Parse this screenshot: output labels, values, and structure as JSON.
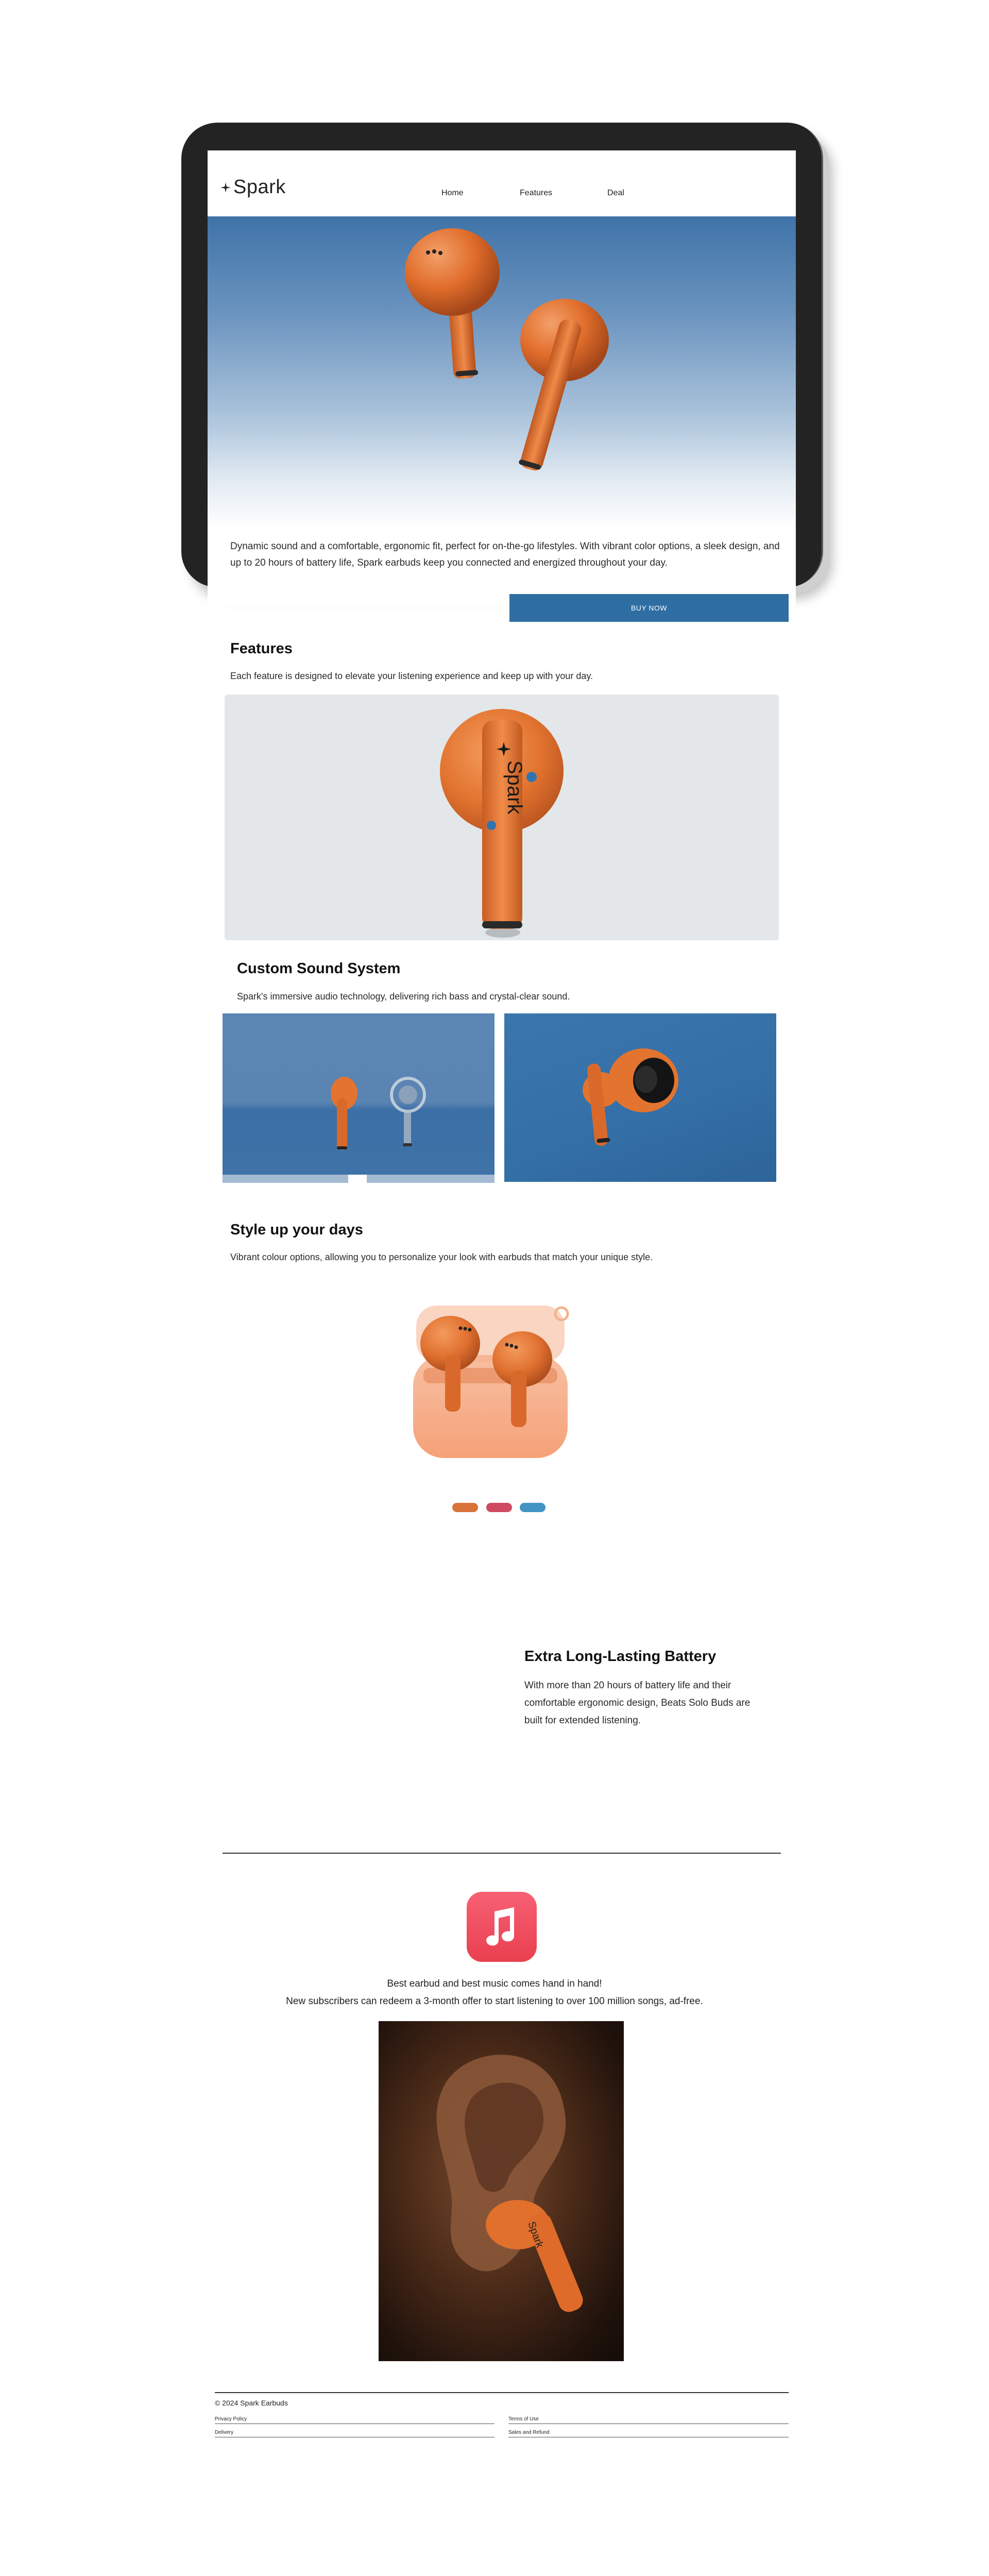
{
  "brand": {
    "name": "Spark"
  },
  "nav": {
    "items": [
      "Home",
      "Features",
      "Deal"
    ]
  },
  "hero": {
    "description": "Dynamic sound and a comfortable, ergonomic fit, perfect for on-the-go lifestyles. With vibrant color options, a sleek design, and up to 20 hours of battery life, Spark earbuds keep you connected and energized throughout your day.",
    "description_line1": "Dynamic sound and a comfortable, ergonomic fit, perfect for on-the-go lifestyles. With vibrant color options, a sleek design, and",
    "description_line2": "up to 20 hours of battery life, Spark earbuds keep you connected and energized throughout your day.",
    "buy_label": "BUY NOW"
  },
  "features": {
    "title": "Features",
    "subtitle": "Each feature is designed to elevate your listening experience and keep up with your day."
  },
  "custom_sound": {
    "title": "Custom Sound System",
    "subtitle": "Spark's immersive audio technology, delivering rich bass and crystal-clear sound."
  },
  "style": {
    "title": "Style up your days",
    "subtitle": "Vibrant colour options, allowing you to personalize your look with earbuds that match your unique style.",
    "swatches": [
      {
        "name": "orange",
        "color": "#d9733a"
      },
      {
        "name": "pink",
        "color": "#cf4a60"
      },
      {
        "name": "blue",
        "color": "#4294c4"
      }
    ]
  },
  "battery": {
    "title": "Extra Long-Lasting Battery",
    "line1": "With more than 20 hours of battery life and their",
    "line2": "comfortable ergonomic design, Beats Solo Buds are",
    "line3": "built for extended listening."
  },
  "music": {
    "icon": "apple-music-icon",
    "line1": "Best earbud and best music comes hand in hand!",
    "line2": "New subscribers can redeem a 3-month offer to start listening to over 100 million songs, ad-free."
  },
  "footer": {
    "copyright": "© 2024 Spark Earbuds",
    "links": [
      "Privacy Policy",
      "Terms of Use",
      "Delivery",
      "Sales and Refund"
    ]
  },
  "colors": {
    "accent": "#2f6ea3",
    "earbud_orange": "#e2732f",
    "hero_blue": "#3f73a8"
  }
}
